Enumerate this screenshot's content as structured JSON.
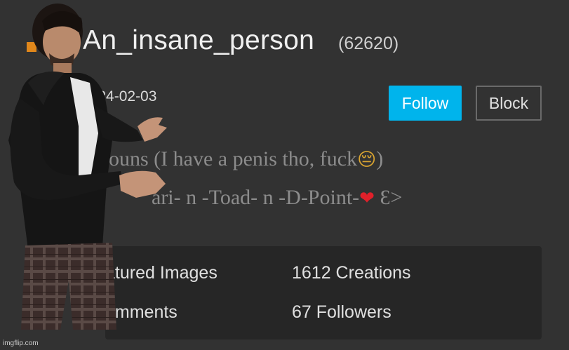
{
  "profile": {
    "username": "An_insane_person",
    "points": "(62620)",
    "join_date": "2024-02-03"
  },
  "actions": {
    "follow_label": "Follow",
    "block_label": "Block"
  },
  "bio": {
    "line1_text": "houns (I have a penis tho, fuck",
    "line1_emoji": "😔",
    "line1_end": ")",
    "line2_text": "ari- n -Toad- n -D-Point-",
    "line2_heart": "❤",
    "line2_end": " Ɛ>"
  },
  "stats": {
    "featured_images": "atured Images",
    "creations": "1612 Creations",
    "comments": "omments",
    "followers": "67 Followers"
  },
  "watermark": "imgflip.com",
  "colors": {
    "background": "#323232",
    "card": "#262626",
    "follow_button": "#00b4ec",
    "block_border": "#6a6a6a"
  }
}
